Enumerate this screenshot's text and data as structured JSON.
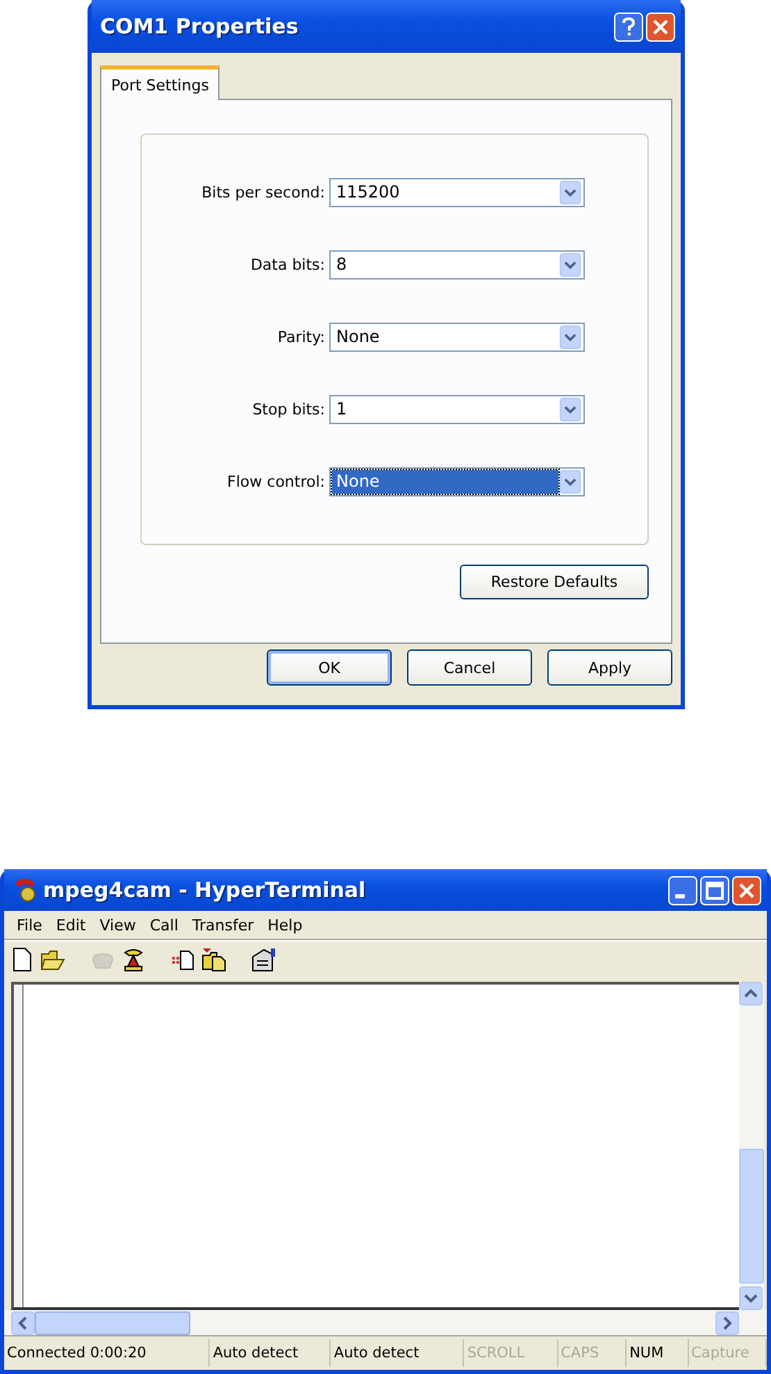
{
  "properties_dialog": {
    "title": "COM1 Properties",
    "tabs": [
      {
        "label": "Port Settings",
        "selected": true
      }
    ],
    "settings": [
      {
        "label": "Bits per second:",
        "value": "115200",
        "focused": false
      },
      {
        "label": "Data bits:",
        "value": "8",
        "focused": false
      },
      {
        "label": "Parity:",
        "value": "None",
        "focused": false
      },
      {
        "label": "Stop bits:",
        "value": "1",
        "focused": false
      },
      {
        "label": "Flow control:",
        "value": "None",
        "focused": true
      }
    ],
    "restore_button": "Restore Defaults",
    "buttons": [
      {
        "label": "OK",
        "default": true
      },
      {
        "label": "Cancel",
        "default": false
      },
      {
        "label": "Apply",
        "default": false
      }
    ]
  },
  "terminal_window": {
    "title": "mpeg4cam - HyperTerminal",
    "menu": [
      "File",
      "Edit",
      "View",
      "Call",
      "Transfer",
      "Help"
    ],
    "toolbar": [
      {
        "kind": "new",
        "disabled": false
      },
      {
        "kind": "open",
        "disabled": false
      },
      {
        "kind": "gap"
      },
      {
        "kind": "disconnect",
        "disabled": true
      },
      {
        "kind": "call",
        "disabled": false
      },
      {
        "kind": "gap"
      },
      {
        "kind": "send",
        "disabled": false
      },
      {
        "kind": "receive",
        "disabled": false
      },
      {
        "kind": "gap"
      },
      {
        "kind": "properties",
        "disabled": false
      }
    ],
    "status_bar": [
      {
        "text": "Connected 0:00:20",
        "disabled": false
      },
      {
        "text": "Auto detect",
        "disabled": false
      },
      {
        "text": "Auto detect",
        "disabled": false
      },
      {
        "text": "SCROLL",
        "disabled": true
      },
      {
        "text": "CAPS",
        "disabled": true
      },
      {
        "text": "NUM",
        "disabled": false
      },
      {
        "text": "Capture",
        "disabled": true
      }
    ]
  }
}
